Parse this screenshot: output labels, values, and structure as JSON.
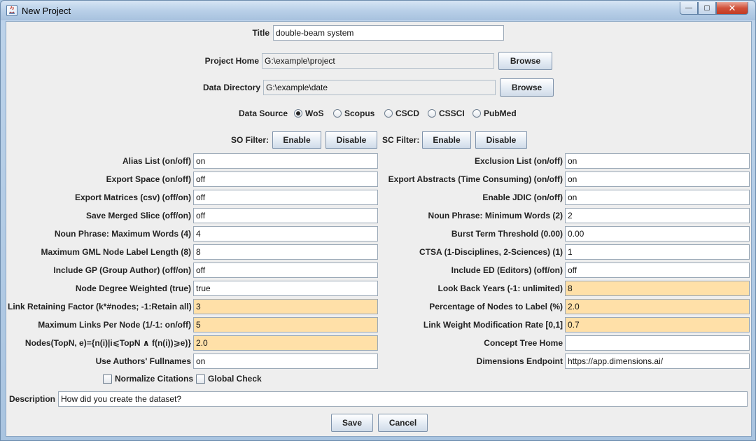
{
  "window": {
    "title": "New Project",
    "controls": {
      "minimize": "—",
      "maximize": "▢",
      "close": "✕"
    }
  },
  "header": {
    "title_label": "Title",
    "title_value": "double-beam system",
    "project_home_label": "Project Home",
    "project_home_value": "G:\\example\\project",
    "data_dir_label": "Data Directory",
    "data_dir_value": "G:\\example\\date",
    "browse_label": "Browse"
  },
  "data_source": {
    "label": "Data Source",
    "options": [
      "WoS",
      "Scopus",
      "CSCD",
      "CSSCI",
      "PubMed"
    ],
    "selected": "WoS"
  },
  "filters": {
    "so_label": "SO Filter:",
    "sc_label": "SC Filter:",
    "enable_label": "Enable",
    "disable_label": "Disable"
  },
  "left_fields": [
    {
      "label": "Alias List (on/off)",
      "value": "on",
      "highlight": false
    },
    {
      "label": "Export Space (on/off)",
      "value": "off",
      "highlight": false
    },
    {
      "label": "Export Matrices (csv) (off/on)",
      "value": "off",
      "highlight": false
    },
    {
      "label": "Save Merged Slice (off/on)",
      "value": "off",
      "highlight": false
    },
    {
      "label": "Noun Phrase: Maximum Words (4)",
      "value": "4",
      "highlight": false
    },
    {
      "label": "Maximum GML Node Label Length (8)",
      "value": "8",
      "highlight": false
    },
    {
      "label": "Include GP (Group Author) (off/on)",
      "value": "off",
      "highlight": false
    },
    {
      "label": "Node Degree Weighted (true)",
      "value": "true",
      "highlight": false
    },
    {
      "label": "Link Retaining Factor (k*#nodes; -1:Retain all)",
      "value": "3",
      "highlight": true
    },
    {
      "label": "Maximum Links Per Node (1/-1: on/off)",
      "value": "5",
      "highlight": true
    },
    {
      "label": "Nodes(TopN, e)={n(i)|i⩽TopN ∧ f(n(i))⩾e)}",
      "value": "2.0",
      "highlight": true
    },
    {
      "label": "Use Authors' Fullnames",
      "value": "on",
      "highlight": false
    }
  ],
  "right_fields": [
    {
      "label": "Exclusion List (on/off)",
      "value": "on",
      "highlight": false
    },
    {
      "label": "Export Abstracts (Time Consuming) (on/off)",
      "value": "on",
      "highlight": false
    },
    {
      "label": "Enable JDIC (on/off)",
      "value": "on",
      "highlight": false
    },
    {
      "label": "Noun Phrase: Minimum Words (2)",
      "value": "2",
      "highlight": false
    },
    {
      "label": "Burst Term Threshold (0.00)",
      "value": "0.00",
      "highlight": false
    },
    {
      "label": "CTSA (1-Disciplines, 2-Sciences) (1)",
      "value": "1",
      "highlight": false
    },
    {
      "label": "Include ED (Editors) (off/on)",
      "value": "off",
      "highlight": false
    },
    {
      "label": "Look Back Years (-1: unlimited)",
      "value": "8",
      "highlight": true
    },
    {
      "label": "Percentage of Nodes to Label (%)",
      "value": "2.0",
      "highlight": true
    },
    {
      "label": "Link Weight Modification Rate [0,1]",
      "value": "0.7",
      "highlight": true
    },
    {
      "label": "Concept Tree Home",
      "value": "",
      "highlight": false
    },
    {
      "label": "Dimensions Endpoint",
      "value": "https://app.dimensions.ai/",
      "highlight": false
    }
  ],
  "checks": {
    "normalize_label": "Normalize Citations",
    "global_label": "Global Check"
  },
  "description": {
    "label": "Description",
    "value": "How did you create the dataset?"
  },
  "footer": {
    "save_label": "Save",
    "cancel_label": "Cancel"
  }
}
